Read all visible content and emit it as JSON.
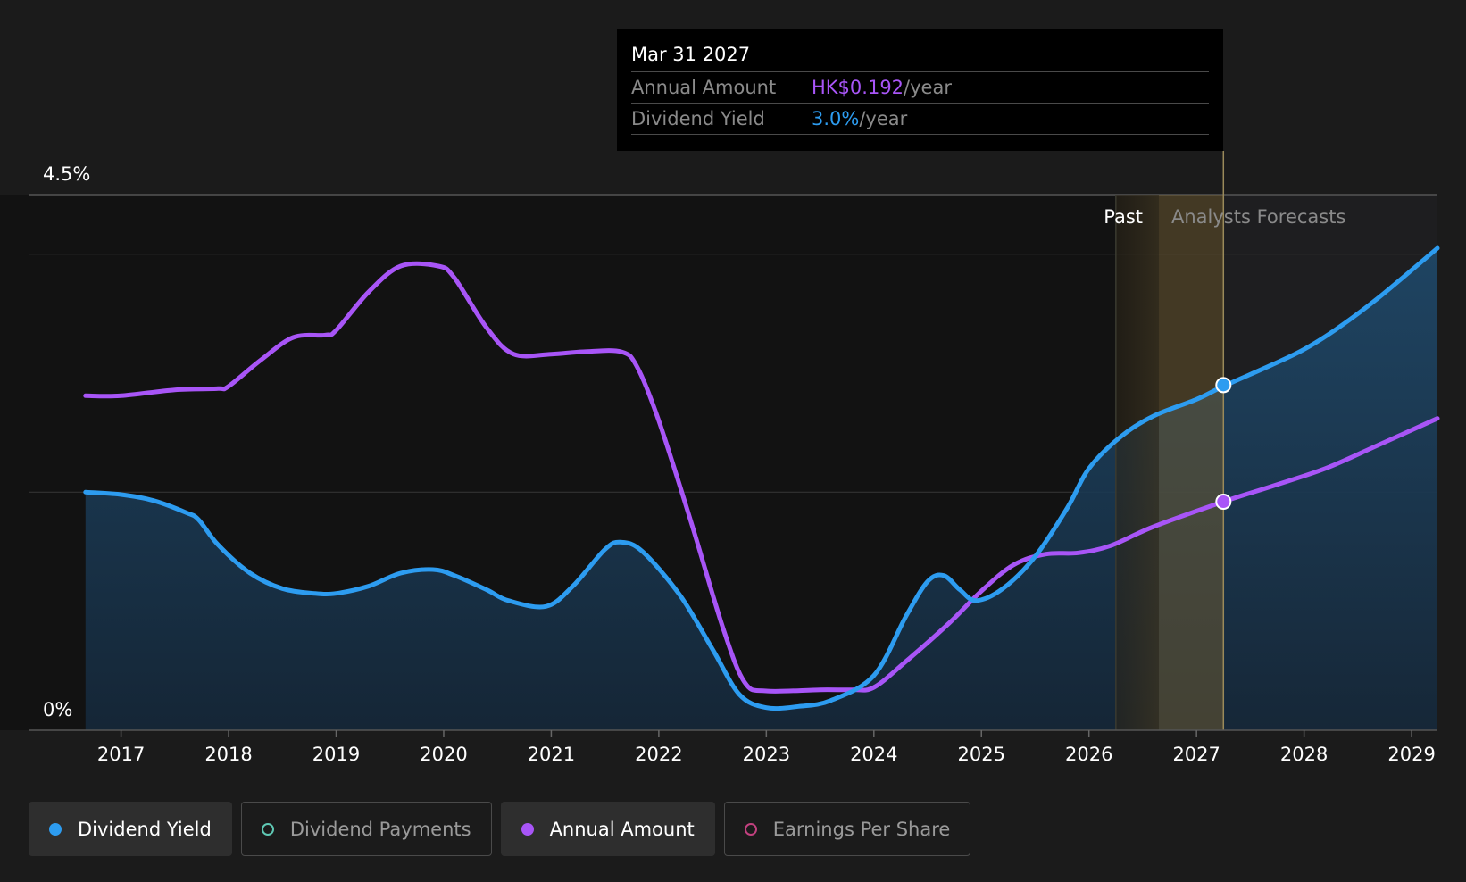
{
  "tooltip": {
    "date": "Mar 31 2027",
    "rows": [
      {
        "label": "Annual Amount",
        "value": "HK$0.192",
        "unit": "/year"
      },
      {
        "label": "Dividend Yield",
        "value": "3.0%",
        "unit": "/year"
      }
    ]
  },
  "legend": [
    {
      "label": "Dividend Yield",
      "active": true,
      "marker": "filled-dot",
      "color": "#2d9cf0"
    },
    {
      "label": "Dividend Payments",
      "active": false,
      "marker": "hollow-dot",
      "color": "#5fc8b4"
    },
    {
      "label": "Annual Amount",
      "active": true,
      "marker": "filled-dot",
      "color": "#a855f7"
    },
    {
      "label": "Earnings Per Share",
      "active": false,
      "marker": "hollow-dot",
      "color": "#c2417f"
    }
  ],
  "chart_data": {
    "type": "line",
    "ylim_pct": [
      0,
      4.5
    ],
    "y_ticks": [
      "4.5%",
      "0%"
    ],
    "x_ticks": [
      "2017",
      "2018",
      "2019",
      "2020",
      "2021",
      "2022",
      "2023",
      "2024",
      "2025",
      "2026",
      "2027",
      "2028",
      "2029"
    ],
    "xlim": [
      2016.14,
      2029.24
    ],
    "region_labels": {
      "past": "Past",
      "forecast": "Analysts Forecasts"
    },
    "forecast_start": 2026.25,
    "past_band_start": 2026.25,
    "highlight_start": 2026.65,
    "cursor_x": 2027.25,
    "grid": true,
    "colors": {
      "yield": "#2d9cf0",
      "annual": "#a855f7"
    },
    "series": [
      {
        "name": "Dividend Yield",
        "color": "#2d9cf0",
        "area": true,
        "unit": "%",
        "points": [
          [
            2016.67,
            2.0
          ],
          [
            2017.0,
            1.98
          ],
          [
            2017.3,
            1.93
          ],
          [
            2017.6,
            1.83
          ],
          [
            2017.72,
            1.77
          ],
          [
            2017.9,
            1.56
          ],
          [
            2018.2,
            1.32
          ],
          [
            2018.5,
            1.19
          ],
          [
            2018.8,
            1.15
          ],
          [
            2019.0,
            1.15
          ],
          [
            2019.3,
            1.21
          ],
          [
            2019.6,
            1.32
          ],
          [
            2019.9,
            1.35
          ],
          [
            2020.1,
            1.3
          ],
          [
            2020.4,
            1.18
          ],
          [
            2020.6,
            1.09
          ],
          [
            2020.95,
            1.04
          ],
          [
            2021.2,
            1.21
          ],
          [
            2021.5,
            1.52
          ],
          [
            2021.65,
            1.58
          ],
          [
            2021.85,
            1.5
          ],
          [
            2022.2,
            1.13
          ],
          [
            2022.5,
            0.68
          ],
          [
            2022.75,
            0.3
          ],
          [
            2023.0,
            0.19
          ],
          [
            2023.3,
            0.2
          ],
          [
            2023.6,
            0.25
          ],
          [
            2024.0,
            0.46
          ],
          [
            2024.3,
            0.96
          ],
          [
            2024.5,
            1.25
          ],
          [
            2024.65,
            1.3
          ],
          [
            2024.8,
            1.18
          ],
          [
            2024.95,
            1.09
          ],
          [
            2025.2,
            1.19
          ],
          [
            2025.5,
            1.46
          ],
          [
            2025.8,
            1.87
          ],
          [
            2026.0,
            2.2
          ],
          [
            2026.3,
            2.47
          ],
          [
            2026.6,
            2.64
          ],
          [
            2027.0,
            2.78
          ],
          [
            2027.25,
            2.89
          ],
          [
            2027.7,
            3.07
          ],
          [
            2028.0,
            3.2
          ],
          [
            2028.3,
            3.37
          ],
          [
            2028.7,
            3.64
          ],
          [
            2029.24,
            4.05
          ]
        ]
      },
      {
        "name": "Annual Amount",
        "color": "#a855f7",
        "area": false,
        "unit": "HK$",
        "points": [
          [
            2016.67,
            0.281
          ],
          [
            2017.0,
            0.281
          ],
          [
            2017.5,
            0.286
          ],
          [
            2017.9,
            0.287
          ],
          [
            2018.0,
            0.289
          ],
          [
            2018.3,
            0.311
          ],
          [
            2018.6,
            0.33
          ],
          [
            2018.9,
            0.332
          ],
          [
            2019.0,
            0.336
          ],
          [
            2019.3,
            0.368
          ],
          [
            2019.6,
            0.39
          ],
          [
            2019.95,
            0.39
          ],
          [
            2020.1,
            0.38
          ],
          [
            2020.4,
            0.338
          ],
          [
            2020.65,
            0.316
          ],
          [
            2021.0,
            0.316
          ],
          [
            2021.3,
            0.318
          ],
          [
            2021.65,
            0.318
          ],
          [
            2021.8,
            0.305
          ],
          [
            2022.0,
            0.26
          ],
          [
            2022.3,
            0.175
          ],
          [
            2022.6,
            0.085
          ],
          [
            2022.8,
            0.04
          ],
          [
            2023.0,
            0.033
          ],
          [
            2023.5,
            0.034
          ],
          [
            2023.8,
            0.034
          ],
          [
            2024.0,
            0.036
          ],
          [
            2024.3,
            0.058
          ],
          [
            2024.7,
            0.09
          ],
          [
            2025.0,
            0.117
          ],
          [
            2025.3,
            0.139
          ],
          [
            2025.6,
            0.148
          ],
          [
            2025.9,
            0.149
          ],
          [
            2026.2,
            0.155
          ],
          [
            2026.6,
            0.171
          ],
          [
            2027.25,
            0.192
          ],
          [
            2027.7,
            0.205
          ],
          [
            2028.2,
            0.22
          ],
          [
            2028.7,
            0.24
          ],
          [
            2029.24,
            0.262
          ]
        ]
      }
    ],
    "cursor_values": {
      "Dividend Yield": 2.9,
      "Annual Amount": 0.192
    }
  }
}
